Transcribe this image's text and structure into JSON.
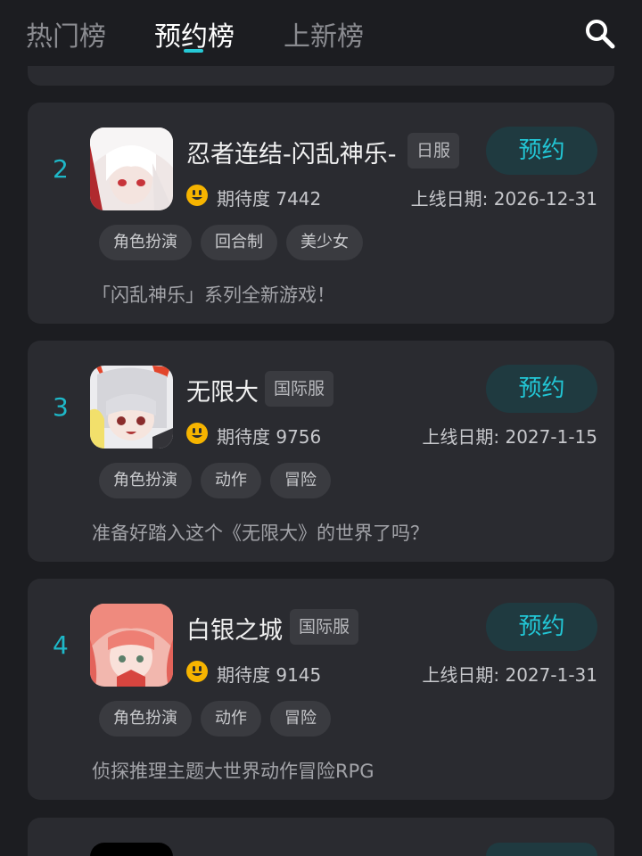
{
  "header": {
    "tabs": [
      "热门榜",
      "预约榜",
      "上新榜"
    ],
    "active_tab": 1
  },
  "games": [
    {
      "rank": "2",
      "title": "忍者连结-闪乱神乐-",
      "region": "日服",
      "reserve_label": "预约",
      "expect_label": "期待度 7442",
      "date_label": "上线日期: 2026-12-31",
      "tags": [
        "角色扮演",
        "回合制",
        "美少女"
      ],
      "desc": "「闪乱神乐」系列全新游戏！",
      "icon_colors": {
        "bg": "#efe7e6",
        "hair": "#f4f1f0",
        "accent": "#b02a2e"
      }
    },
    {
      "rank": "3",
      "title": "无限大",
      "region": "国际服",
      "reserve_label": "预约",
      "expect_label": "期待度 9756",
      "date_label": "上线日期: 2027-1-15",
      "tags": [
        "角色扮演",
        "动作",
        "冒险"
      ],
      "desc": "准备好踏入这个《无限大》的世界了吗？",
      "icon_colors": {
        "bg": "#e3e3e6",
        "hair": "#d9d9de",
        "accent": "#e2452b"
      }
    },
    {
      "rank": "4",
      "title": "白银之城",
      "region": "国际服",
      "reserve_label": "预约",
      "expect_label": "期待度 9145",
      "date_label": "上线日期: 2027-1-31",
      "tags": [
        "角色扮演",
        "动作",
        "冒险"
      ],
      "desc": "侦探推理主题大世界动作冒险RPG",
      "icon_colors": {
        "bg": "#f2b7ae",
        "hair": "#ee7f74",
        "accent": "#d7453f"
      }
    }
  ],
  "colors": {
    "accent": "#22c7d6",
    "card": "#2a2b30",
    "background": "#1c1d21",
    "smiley": "#f6b400"
  }
}
